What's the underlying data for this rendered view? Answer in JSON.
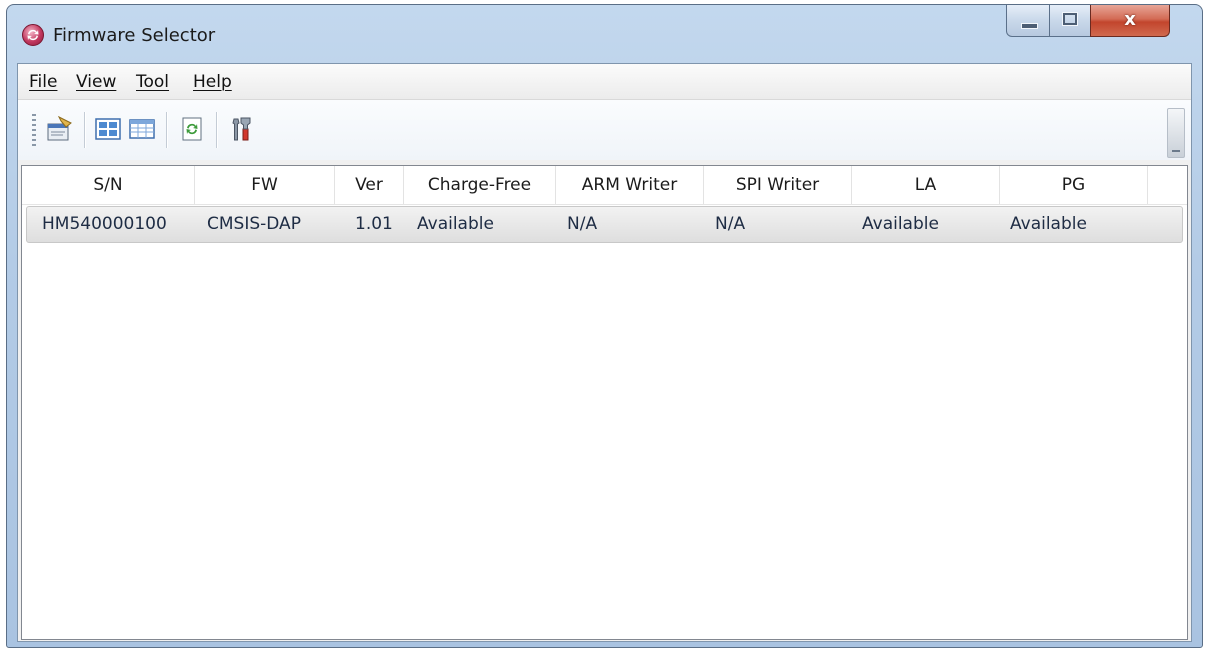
{
  "window": {
    "title": "Firmware Selector",
    "controls": {
      "minimize": "minimize",
      "maximize": "maximize",
      "close": "x"
    }
  },
  "menu": [
    {
      "label": "File"
    },
    {
      "label": "View"
    },
    {
      "label": "Tool"
    },
    {
      "label": "Help"
    }
  ],
  "toolbar": {
    "buttons": [
      {
        "icon": "properties-icon"
      },
      {
        "icon": "large-icons-view-icon"
      },
      {
        "icon": "details-view-icon"
      },
      {
        "icon": "refresh-icon"
      },
      {
        "icon": "tools-icon"
      }
    ]
  },
  "table": {
    "columns": [
      "S/N",
      "FW",
      "Ver",
      "Charge-Free",
      "ARM Writer",
      "SPI Writer",
      "LA",
      "PG"
    ],
    "rows": [
      {
        "sn": "HM540000100",
        "fw": "CMSIS-DAP",
        "ver": "1.01",
        "charge_free": "Available",
        "arm_writer": "N/A",
        "spi_writer": "N/A",
        "la": "Available",
        "pg": "Available"
      }
    ]
  },
  "colors": {
    "titlebar": "#b3cbe6",
    "close_button": "#c2452d",
    "row_selected": "#e6e6e6"
  }
}
